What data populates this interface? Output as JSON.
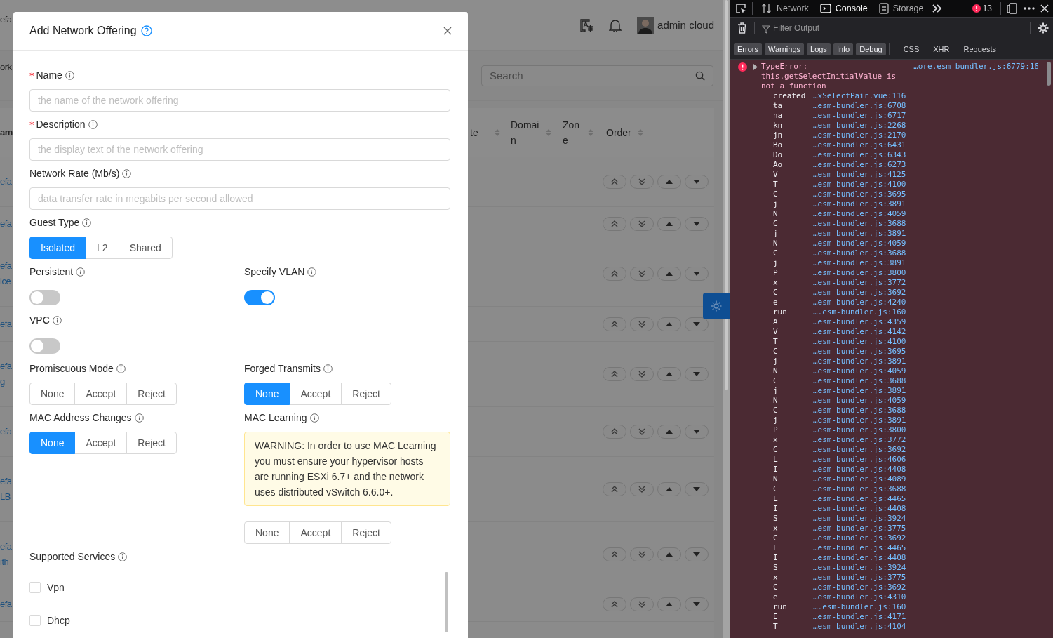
{
  "background_page": {
    "header": {
      "left_text": "efa",
      "user_name": "admin cloud"
    },
    "toolbar": {
      "left_text": "ork",
      "search": {
        "placeholder": "Search"
      }
    },
    "table": {
      "columns": [
        {
          "label": "am"
        },
        {
          "label": "te"
        },
        {
          "label": "Domain"
        },
        {
          "label": "Zone"
        },
        {
          "label": "Order"
        }
      ],
      "rows": [
        {
          "name_lines": [
            "efa"
          ]
        },
        {
          "name_lines": [
            "efa"
          ]
        },
        {
          "name_lines": [
            "efa",
            "ice"
          ]
        },
        {
          "name_lines": [
            "efa"
          ]
        },
        {
          "name_lines": [
            "efa",
            "g"
          ]
        },
        {
          "name_lines": [
            "efa"
          ]
        },
        {
          "name_lines": [
            "efa",
            "LB"
          ]
        },
        {
          "name_lines": [
            "efa",
            "ith"
          ]
        },
        {
          "name_lines": [
            "efa"
          ]
        }
      ]
    }
  },
  "modal": {
    "title": "Add Network Offering",
    "fields": [
      {
        "kind": "input",
        "label": "Name",
        "required_mark": "*",
        "placeholder": "the name of the network offering"
      },
      {
        "kind": "input",
        "label": "Description",
        "required_mark": "*",
        "placeholder": "the display text of the network offering"
      },
      {
        "kind": "input",
        "label": "Network Rate (Mb/s)",
        "placeholder": "data transfer rate in megabits per second allowed"
      },
      {
        "kind": "radio",
        "label": "Guest Type",
        "options": [
          {
            "label": "Isolated",
            "selected": true
          },
          {
            "label": "L2",
            "selected": false
          },
          {
            "label": "Shared",
            "selected": false
          }
        ]
      }
    ],
    "grid_rows": [
      {
        "left": {
          "kind": "switch",
          "label": "Persistent",
          "on": false
        },
        "right": {
          "kind": "switch",
          "label": "Specify VLAN",
          "on": true
        }
      },
      {
        "left": {
          "kind": "switch",
          "label": "VPC",
          "on": false
        }
      },
      {
        "left": {
          "kind": "radio",
          "label": "Promiscuous Mode",
          "options": [
            {
              "label": "None",
              "selected": false
            },
            {
              "label": "Accept",
              "selected": false
            },
            {
              "label": "Reject",
              "selected": false
            }
          ]
        },
        "right": {
          "kind": "radio",
          "label": "Forged Transmits",
          "options": [
            {
              "label": "None",
              "selected": true
            },
            {
              "label": "Accept",
              "selected": false
            },
            {
              "label": "Reject",
              "selected": false
            }
          ]
        }
      },
      {
        "left": {
          "kind": "radio",
          "label": "MAC Address Changes",
          "options": [
            {
              "label": "None",
              "selected": true
            },
            {
              "label": "Accept",
              "selected": false
            },
            {
              "label": "Reject",
              "selected": false
            }
          ]
        },
        "right": {
          "kind": "radio",
          "label": "MAC Learning",
          "warning": "WARNING: In order to use MAC Learning you must ensure your hypervisor hosts are running ESXi 6.7+ and the network uses distributed vSwitch 6.6.0+.",
          "options": [
            {
              "label": "None",
              "selected": false
            },
            {
              "label": "Accept",
              "selected": false
            },
            {
              "label": "Reject",
              "selected": false
            }
          ]
        }
      }
    ],
    "supported_services": {
      "label": "Supported Services",
      "items": [
        {
          "label": "Vpn",
          "checked": false
        },
        {
          "label": "Dhcp",
          "checked": false
        }
      ]
    }
  },
  "devtools": {
    "tabs": [
      {
        "label": "Network",
        "selected": false
      },
      {
        "label": "Console",
        "selected": true
      },
      {
        "label": "Storage",
        "selected": false
      }
    ],
    "error_count": "13",
    "filter": {
      "placeholder": "Filter Output"
    },
    "level_filters": [
      {
        "label": "Errors",
        "on": true
      },
      {
        "label": "Warnings",
        "on": true
      },
      {
        "label": "Logs",
        "on": true
      },
      {
        "label": "Info",
        "on": true
      },
      {
        "label": "Debug",
        "on": true
      }
    ],
    "type_filters": [
      {
        "label": "CSS",
        "on": false
      },
      {
        "label": "XHR",
        "on": false
      },
      {
        "label": "Requests",
        "on": false
      }
    ],
    "error": {
      "message": "TypeError: this.getSelectInitialValue is not a function",
      "location": "…ore.esm-bundler.js:6779:16",
      "frames": [
        {
          "fn": "created",
          "loc": "…xSelectPair.vue:116"
        },
        {
          "fn": "ta",
          "loc": "…esm-bundler.js:6708"
        },
        {
          "fn": "na",
          "loc": "…esm-bundler.js:6717"
        },
        {
          "fn": "kn",
          "loc": "…esm-bundler.js:2268"
        },
        {
          "fn": "jn",
          "loc": "…esm-bundler.js:2170"
        },
        {
          "fn": "Bo",
          "loc": "…esm-bundler.js:6431"
        },
        {
          "fn": "Do",
          "loc": "…esm-bundler.js:6343"
        },
        {
          "fn": "Ao",
          "loc": "…esm-bundler.js:6273"
        },
        {
          "fn": "V",
          "loc": "…esm-bundler.js:4125"
        },
        {
          "fn": "T",
          "loc": "…esm-bundler.js:4100"
        },
        {
          "fn": "C",
          "loc": "…esm-bundler.js:3695"
        },
        {
          "fn": "j",
          "loc": "…esm-bundler.js:3891"
        },
        {
          "fn": "N",
          "loc": "…esm-bundler.js:4059"
        },
        {
          "fn": "C",
          "loc": "…esm-bundler.js:3688"
        },
        {
          "fn": "j",
          "loc": "…esm-bundler.js:3891"
        },
        {
          "fn": "N",
          "loc": "…esm-bundler.js:4059"
        },
        {
          "fn": "C",
          "loc": "…esm-bundler.js:3688"
        },
        {
          "fn": "j",
          "loc": "…esm-bundler.js:3891"
        },
        {
          "fn": "P",
          "loc": "…esm-bundler.js:3800"
        },
        {
          "fn": "x",
          "loc": "…esm-bundler.js:3772"
        },
        {
          "fn": "C",
          "loc": "…esm-bundler.js:3692"
        },
        {
          "fn": "e",
          "loc": "…esm-bundler.js:4240"
        },
        {
          "fn": "run",
          "loc": "….esm-bundler.js:160"
        },
        {
          "fn": "A",
          "loc": "…esm-bundler.js:4359"
        },
        {
          "fn": "V",
          "loc": "…esm-bundler.js:4142"
        },
        {
          "fn": "T",
          "loc": "…esm-bundler.js:4100"
        },
        {
          "fn": "C",
          "loc": "…esm-bundler.js:3695"
        },
        {
          "fn": "j",
          "loc": "…esm-bundler.js:3891"
        },
        {
          "fn": "N",
          "loc": "…esm-bundler.js:4059"
        },
        {
          "fn": "C",
          "loc": "…esm-bundler.js:3688"
        },
        {
          "fn": "j",
          "loc": "…esm-bundler.js:3891"
        },
        {
          "fn": "N",
          "loc": "…esm-bundler.js:4059"
        },
        {
          "fn": "C",
          "loc": "…esm-bundler.js:3688"
        },
        {
          "fn": "j",
          "loc": "…esm-bundler.js:3891"
        },
        {
          "fn": "P",
          "loc": "…esm-bundler.js:3800"
        },
        {
          "fn": "x",
          "loc": "…esm-bundler.js:3772"
        },
        {
          "fn": "C",
          "loc": "…esm-bundler.js:3692"
        },
        {
          "fn": "L",
          "loc": "…esm-bundler.js:4606"
        },
        {
          "fn": "I",
          "loc": "…esm-bundler.js:4408"
        },
        {
          "fn": "N",
          "loc": "…esm-bundler.js:4089"
        },
        {
          "fn": "C",
          "loc": "…esm-bundler.js:3688"
        },
        {
          "fn": "L",
          "loc": "…esm-bundler.js:4465"
        },
        {
          "fn": "I",
          "loc": "…esm-bundler.js:4408"
        },
        {
          "fn": "S",
          "loc": "…esm-bundler.js:3924"
        },
        {
          "fn": "x",
          "loc": "…esm-bundler.js:3775"
        },
        {
          "fn": "C",
          "loc": "…esm-bundler.js:3692"
        },
        {
          "fn": "L",
          "loc": "…esm-bundler.js:4465"
        },
        {
          "fn": "I",
          "loc": "…esm-bundler.js:4408"
        },
        {
          "fn": "S",
          "loc": "…esm-bundler.js:3924"
        },
        {
          "fn": "x",
          "loc": "…esm-bundler.js:3775"
        },
        {
          "fn": "C",
          "loc": "…esm-bundler.js:3692"
        },
        {
          "fn": "e",
          "loc": "…esm-bundler.js:4310"
        },
        {
          "fn": "run",
          "loc": "….esm-bundler.js:160"
        },
        {
          "fn": "E",
          "loc": "…esm-bundler.js:4171"
        },
        {
          "fn": "T",
          "loc": "…esm-bundler.js:4104"
        }
      ]
    }
  }
}
